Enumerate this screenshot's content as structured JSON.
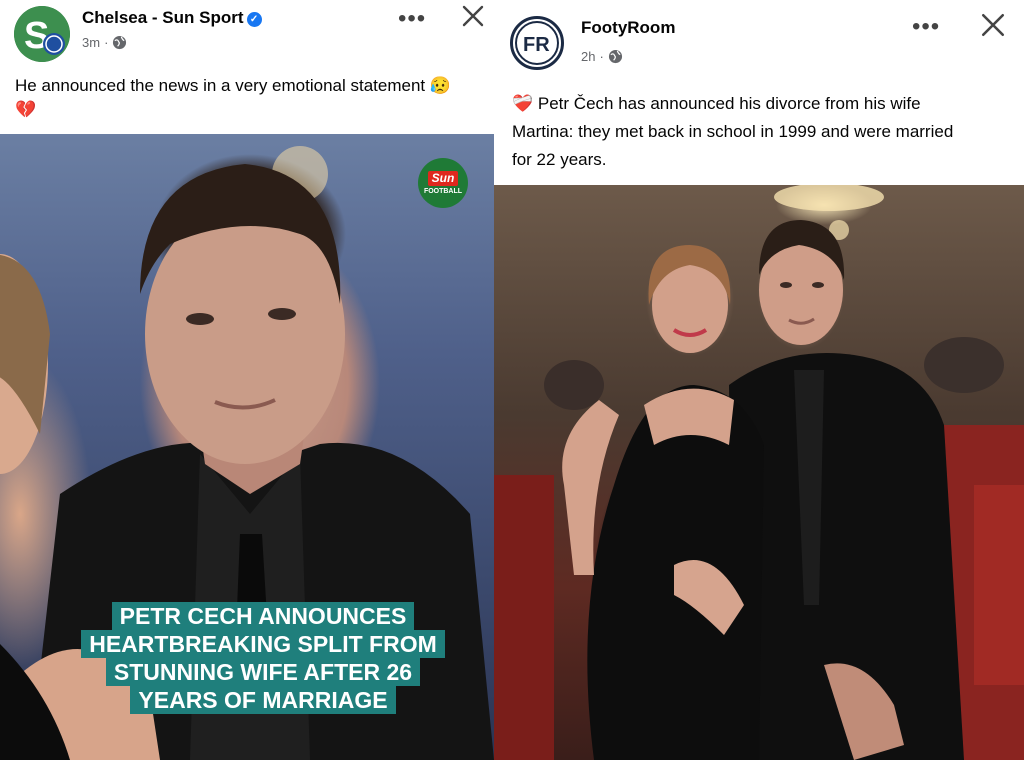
{
  "left_post": {
    "page_name": "Chelsea - Sun Sport",
    "time": "3m",
    "dot": "·",
    "caption": "He announced the news in a very emotional statement 😥",
    "caption_line2": "💔",
    "more_label": "•••",
    "badge": {
      "brand": "Sun",
      "sub": "FOOTBALL"
    },
    "headline": [
      "PETR CECH ANNOUNCES",
      "HEARTBREAKING SPLIT FROM",
      "STUNNING WIFE AFTER 26",
      "YEARS OF MARRIAGE"
    ],
    "icons": [
      "chelsea-avatar",
      "verified-badge-icon",
      "globe-icon",
      "more-icon",
      "close-icon"
    ]
  },
  "right_post": {
    "page_name": "FootyRoom",
    "time": "2h",
    "dot": "·",
    "caption_lines": [
      "❤️‍🩹 Petr Čech has announced his divorce from his wife",
      "Martina: they met back in school in 1999 and were married",
      "for 22 years."
    ],
    "more_label": "•••",
    "avatar_text": "FR",
    "icons": [
      "footyroom-avatar",
      "globe-icon",
      "more-icon",
      "close-icon"
    ]
  },
  "colors": {
    "headline_bg": "#1f7f7c",
    "verified": "#1877f2",
    "meta_text": "#65676b",
    "sun_red": "#e0281e",
    "sun_green": "#1f7a36"
  }
}
